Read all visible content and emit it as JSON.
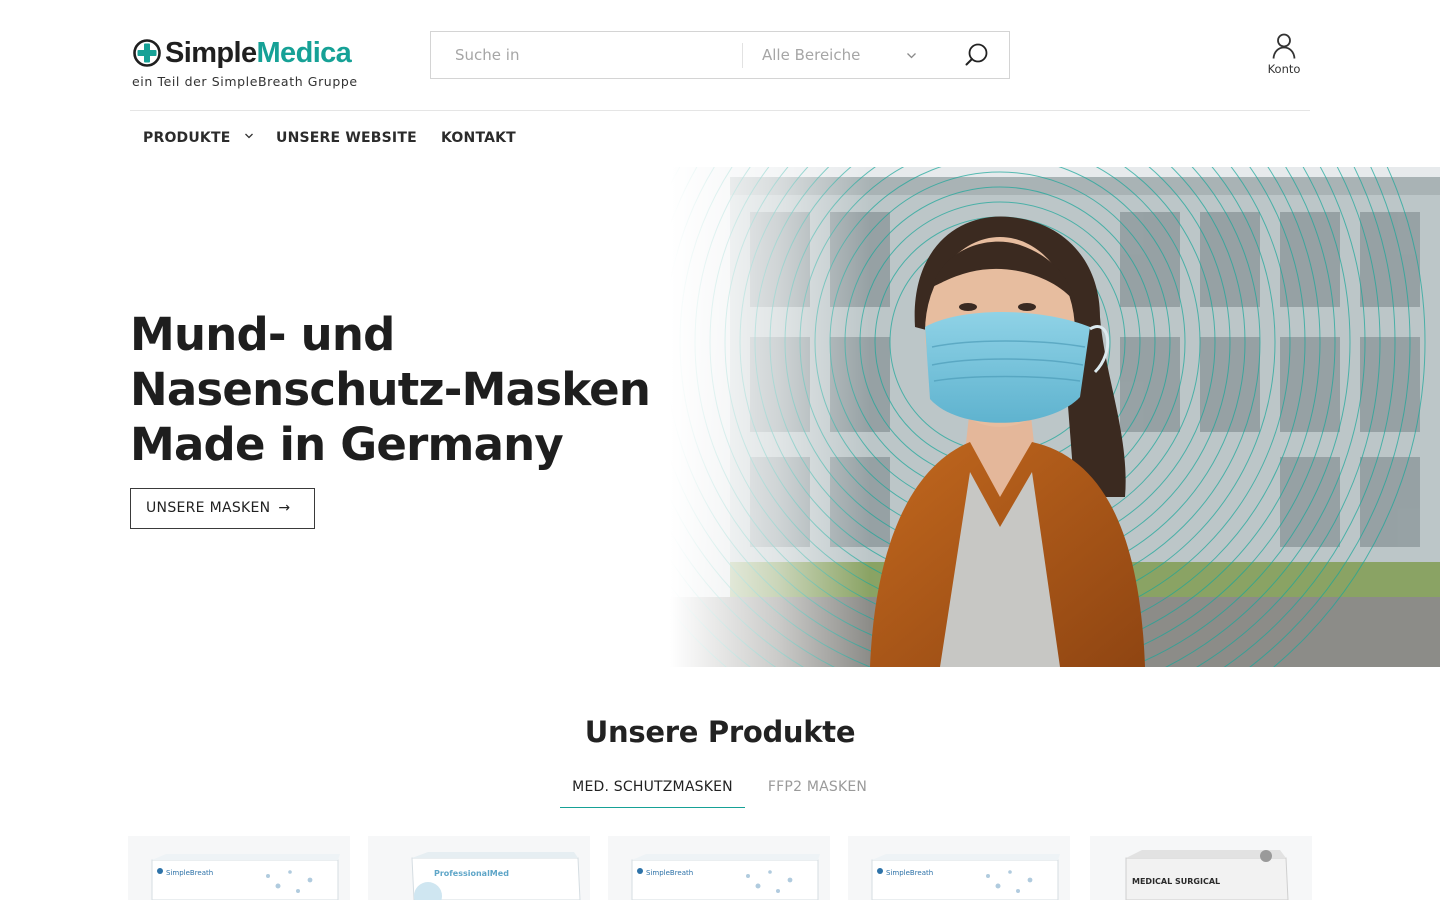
{
  "brand": {
    "name_part1": "Simple",
    "name_part2": "Medica",
    "tagline": "ein Teil der SimpleBreath Gruppe",
    "accent_color": "#16a196",
    "logo_icon": "plus-circle-icon"
  },
  "search": {
    "placeholder": "Suche in",
    "category_value": "Alle Bereiche",
    "submit_icon": "search-icon"
  },
  "account": {
    "label": "Konto",
    "icon": "user-icon"
  },
  "nav": {
    "items": [
      {
        "label": "PRODUKTE",
        "has_dropdown": true
      },
      {
        "label": "UNSERE WEBSITE",
        "has_dropdown": false
      },
      {
        "label": "KONTAKT",
        "has_dropdown": false
      }
    ]
  },
  "hero": {
    "title_lines": [
      "Mund- und",
      "Nasenschutz-Masken",
      "Made in Germany"
    ],
    "cta_label": "UNSERE MASKEN",
    "cta_arrow": "→"
  },
  "products": {
    "heading": "Unsere Produkte",
    "tabs": [
      {
        "label": "MED. SCHUTZMASKEN",
        "active": true
      },
      {
        "label": "FFP2 MASKEN",
        "active": false
      }
    ],
    "cards": [
      {
        "box_brand": "SimpleBreath"
      },
      {
        "box_brand": "ProfessionalMed"
      },
      {
        "box_brand": "SimpleBreath"
      },
      {
        "box_brand": "SimpleBreath"
      },
      {
        "box_brand": "MEDICAL SURGICAL"
      }
    ]
  }
}
